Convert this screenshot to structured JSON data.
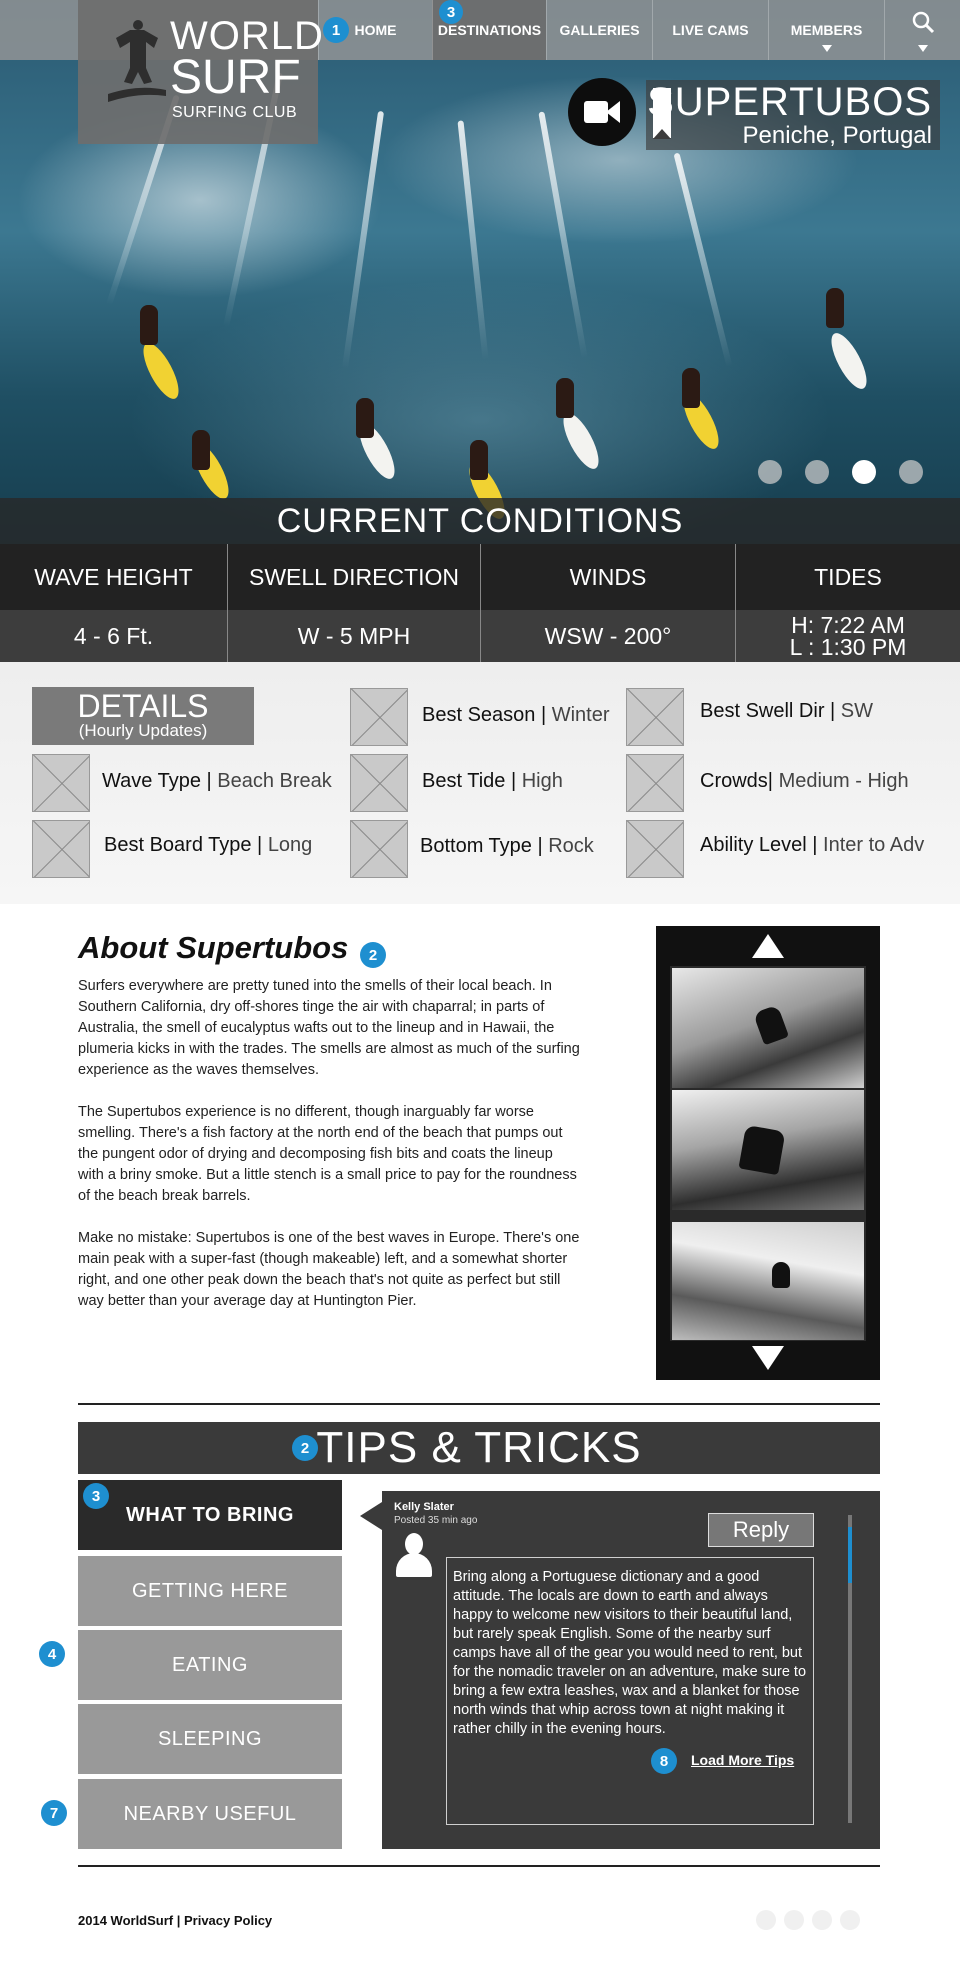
{
  "brand": {
    "line1": "WORLD",
    "line2": "SURF",
    "line3": "SURFING CLUB"
  },
  "nav": {
    "items": [
      {
        "label": "HOME",
        "badge": "1"
      },
      {
        "label": "DESTINATIONS",
        "badge": "3"
      },
      {
        "label": "GALLERIES"
      },
      {
        "label": "LIVE CAMS"
      },
      {
        "label": "MEMBERS"
      }
    ],
    "active": "DESTINATIONS"
  },
  "hero": {
    "spot_name": "SUPERTUBOS",
    "spot_location": "Peniche, Portugal",
    "carousel": {
      "total": 4,
      "active_index": 3
    },
    "icons": [
      "video-camera-icon",
      "bookmark-icon",
      "search-icon"
    ]
  },
  "conditions": {
    "title": "CURRENT CONDITIONS",
    "columns": [
      {
        "label": "WAVE HEIGHT",
        "value": "4 - 6 Ft."
      },
      {
        "label": "SWELL DIRECTION",
        "value": "W - 5 MPH"
      },
      {
        "label": "WINDS",
        "value": "WSW - 200°"
      },
      {
        "label": "TIDES",
        "value": "H: 7:22 AM",
        "value2": "L : 1:30 PM"
      }
    ]
  },
  "details": {
    "heading": "DETAILS",
    "subheading": "(Hourly Updates)",
    "items": [
      {
        "label": "Wave Type",
        "value": "Beach Break"
      },
      {
        "label": "Best Board Type",
        "value": "Long"
      },
      {
        "label": "Best Season",
        "value": "Winter"
      },
      {
        "label": "Best Tide",
        "value": "High"
      },
      {
        "label": "Bottom Type",
        "value": "Rock"
      },
      {
        "label": "Best Swell Dir",
        "value": "SW"
      },
      {
        "label": "Crowds",
        "value": "Medium - High"
      },
      {
        "label": "Ability Level",
        "value": "Inter to Adv"
      }
    ]
  },
  "about": {
    "title": "About Supertubos",
    "badge": "2",
    "paragraphs": [
      "Surfers everywhere are pretty tuned into the smells of their local beach. In Southern California, dry off-shores tinge the air with chaparral; in parts of Australia, the smell of eucalyptus wafts out to the lineup and in Hawaii, the plumeria kicks in with the trades. The smells are almost as much of the surfing experience as the waves themselves.",
      "The Supertubos experience is no different, though inarguably far worse smelling. There's a fish factory at the north end of the beach that pumps out the pungent odor of drying and decomposing fish bits and coats the lineup with a briny smoke. But a little stench is a small price to pay for the roundness of the beach break barrels.",
      "Make no mistake: Supertubos is one of the best waves in Europe. There's one main peak with a super-fast (though makeable) left, and a somewhat shorter right, and one other peak down the beach that's not quite as perfect but still way better than your average day at Huntington Pier."
    ]
  },
  "tips": {
    "heading": "TIPS & TRICKS",
    "heading_badge": "2",
    "tabs": [
      {
        "label": "WHAT TO BRING",
        "badge": "3"
      },
      {
        "label": "GETTING HERE"
      },
      {
        "label": "EATING",
        "badge": "4"
      },
      {
        "label": "SLEEPING"
      },
      {
        "label": "NEARBY USEFUL",
        "badge": "7"
      }
    ],
    "active_tab": "WHAT TO BRING",
    "post": {
      "author": "Kelly Slater",
      "time": "Posted 35 min ago",
      "reply_label": "Reply",
      "text": "Bring along a Portuguese dictionary and a good attitude. The locals are down to earth and always happy to welcome new visitors to their beautiful land, but rarely speak English. Some of the nearby surf camps have all of the gear you would need to rent, but for the nomadic traveler on an adventure, make sure to bring a few extra leashes, wax and a blanket for those north winds that whip across town at night making it rather chilly in the evening hours.",
      "load_more": "Load More Tips",
      "load_more_badge": "8"
    }
  },
  "footer": {
    "text": "2014 WorldSurf | Privacy Policy"
  },
  "colors": {
    "accent": "#1e8fd0",
    "dark": "#2a2a2a",
    "tab": "#999999"
  }
}
